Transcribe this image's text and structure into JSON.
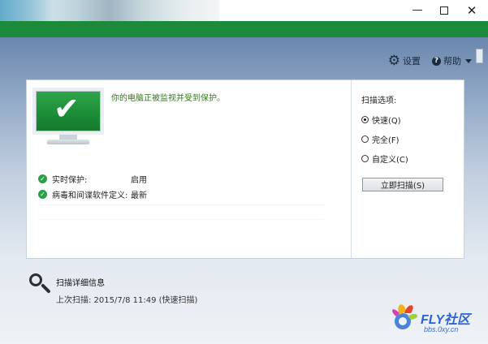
{
  "titlebar": {
    "minimize_glyph": "—",
    "close_glyph": "✕"
  },
  "topnav": {
    "settings_label": "设置",
    "settings_icon": "gear-icon",
    "help_label": "帮助",
    "help_icon": "question-icon",
    "help_glyph": "?"
  },
  "status": {
    "message": "你的电脑正被监视并受到保护。",
    "rows": [
      {
        "label": "实时保护:",
        "value": "启用"
      },
      {
        "label": "病毒和间谍软件定义:",
        "value": "最新"
      }
    ],
    "ok_glyph": "✓"
  },
  "scan_options": {
    "title": "扫描选项:",
    "options": [
      {
        "label": "快速(Q)",
        "selected": true
      },
      {
        "label": "完全(F)",
        "selected": false
      },
      {
        "label": "自定义(C)",
        "selected": false
      }
    ],
    "scan_now_label": "立即扫描(S)"
  },
  "scan_details": {
    "title": "扫描详细信息",
    "last_scan": "上次扫描: 2015/7/8 11:49 (快速扫描)"
  },
  "watermark": {
    "brand": "FLY社区",
    "url": "bbs.0xy.cn"
  },
  "colors": {
    "accent_green": "#1b8b3b",
    "status_green": "#2f7a18",
    "blue_bg": "#8ea6c4"
  }
}
